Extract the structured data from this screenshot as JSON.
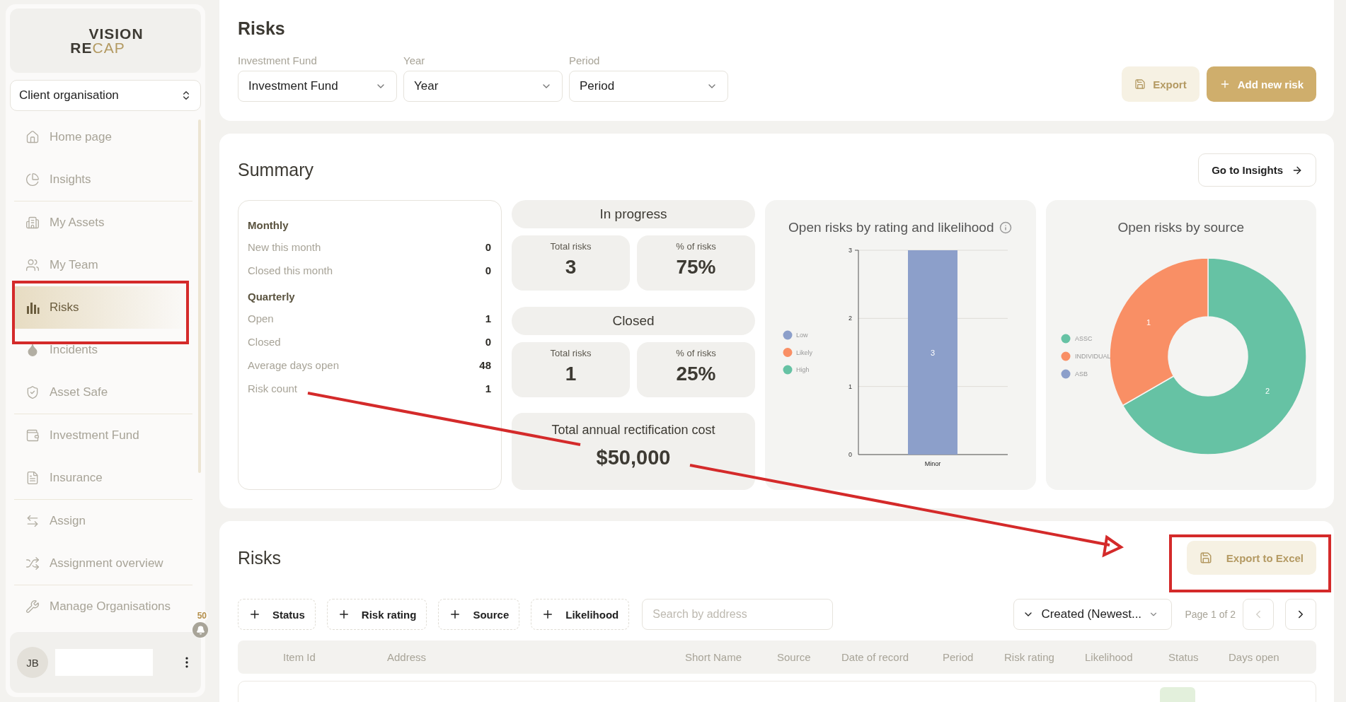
{
  "sidebar": {
    "logo": {
      "line_1": "VISION",
      "line_2_bold": "RE",
      "line_2_light": "CAP"
    },
    "org_select": "Client organisation",
    "nav_groups": [
      {
        "items": [
          {
            "label": "Home page",
            "selected": false
          },
          {
            "label": "Insights",
            "selected": false
          }
        ]
      },
      {
        "items": [
          {
            "label": "My Assets",
            "selected": false
          },
          {
            "label": "My Team",
            "selected": false
          },
          {
            "label": "Risks",
            "selected": true
          },
          {
            "label": "Incidents",
            "selected": false
          },
          {
            "label": "Asset Safe",
            "selected": false
          }
        ]
      },
      {
        "items": [
          {
            "label": "Investment Fund",
            "selected": false
          },
          {
            "label": "Insurance",
            "selected": false
          }
        ]
      },
      {
        "items": [
          {
            "label": "Assign",
            "selected": false
          },
          {
            "label": "Assignment overview",
            "selected": false
          }
        ]
      },
      {
        "items": [
          {
            "label": "Manage Organisations",
            "selected": false
          }
        ]
      }
    ],
    "notifications": "50",
    "user": {
      "initials": "JB"
    }
  },
  "header": {
    "title": "Risks",
    "filters": [
      {
        "label": "Investment Fund",
        "value": "Investment Fund"
      },
      {
        "label": "Year",
        "value": "Year"
      },
      {
        "label": "Period",
        "value": "Period"
      }
    ],
    "buttons": [
      {
        "label": "Export",
        "kind": "secondary"
      },
      {
        "label": "Add new risk",
        "kind": "primary"
      }
    ]
  },
  "summary": {
    "title": "Summary",
    "insights_button": "Go to Insights",
    "stats": [
      {
        "heading": "Monthly",
        "rows": [
          {
            "label": "New this month",
            "value": "0"
          },
          {
            "label": "Closed this month",
            "value": "0"
          }
        ]
      },
      {
        "heading": "Quarterly",
        "rows": [
          {
            "label": "Open",
            "value": "1"
          },
          {
            "label": "Closed",
            "value": "0"
          },
          {
            "label": "Average days open",
            "value": "48"
          },
          {
            "label": "Risk count",
            "value": "1"
          }
        ]
      }
    ],
    "status_groups": [
      {
        "title": "In progress",
        "tiles": [
          {
            "label": "Total risks",
            "value": "3"
          },
          {
            "label": "% of risks",
            "value": "75%"
          }
        ]
      },
      {
        "title": "Closed",
        "tiles": [
          {
            "label": "Total risks",
            "value": "1"
          },
          {
            "label": "% of risks",
            "value": "25%"
          }
        ]
      }
    ],
    "cost": {
      "label": "Total annual rectification cost",
      "value": "$50,000"
    },
    "rating_chart": {
      "title": "Open risks by rating and likelihood",
      "chart_data": {
        "type": "bar",
        "categories": [
          "Minor"
        ],
        "stacked": true,
        "data_labels": true,
        "legend": true,
        "ylim": [
          0,
          3
        ],
        "yticks": [
          0,
          1,
          2,
          3
        ],
        "series": [
          {
            "name": "Low",
            "color": "#8c9fca",
            "values": [
              3
            ]
          },
          {
            "name": "Likely",
            "color": "#f98f65",
            "values": [
              null
            ]
          },
          {
            "name": "High",
            "color": "#66c2a4",
            "values": [
              null
            ]
          }
        ]
      }
    },
    "source_chart": {
      "title": "Open risks by source",
      "chart_data": {
        "type": "donut",
        "categories": [
          "ASSC",
          "INDIVIDUAL",
          "ASB"
        ],
        "legend": true,
        "data_labels": true,
        "values": [
          2,
          1,
          null
        ],
        "colors": [
          "#66c2a4",
          "#f98f65",
          "#8c9fca"
        ]
      }
    }
  },
  "risks": {
    "title": "Risks",
    "export_button": "Export to Excel",
    "filters": [
      "Status",
      "Risk rating",
      "Source",
      "Likelihood"
    ],
    "search": {
      "placeholder": "Search by address"
    },
    "sort": "Created (Newest...",
    "page": "Page 1 of 2",
    "columns": [
      "Item Id",
      "Address",
      "Short Name",
      "Source",
      "Date of record",
      "Period",
      "Risk rating",
      "Likelihood",
      "Status",
      "Days open"
    ]
  }
}
